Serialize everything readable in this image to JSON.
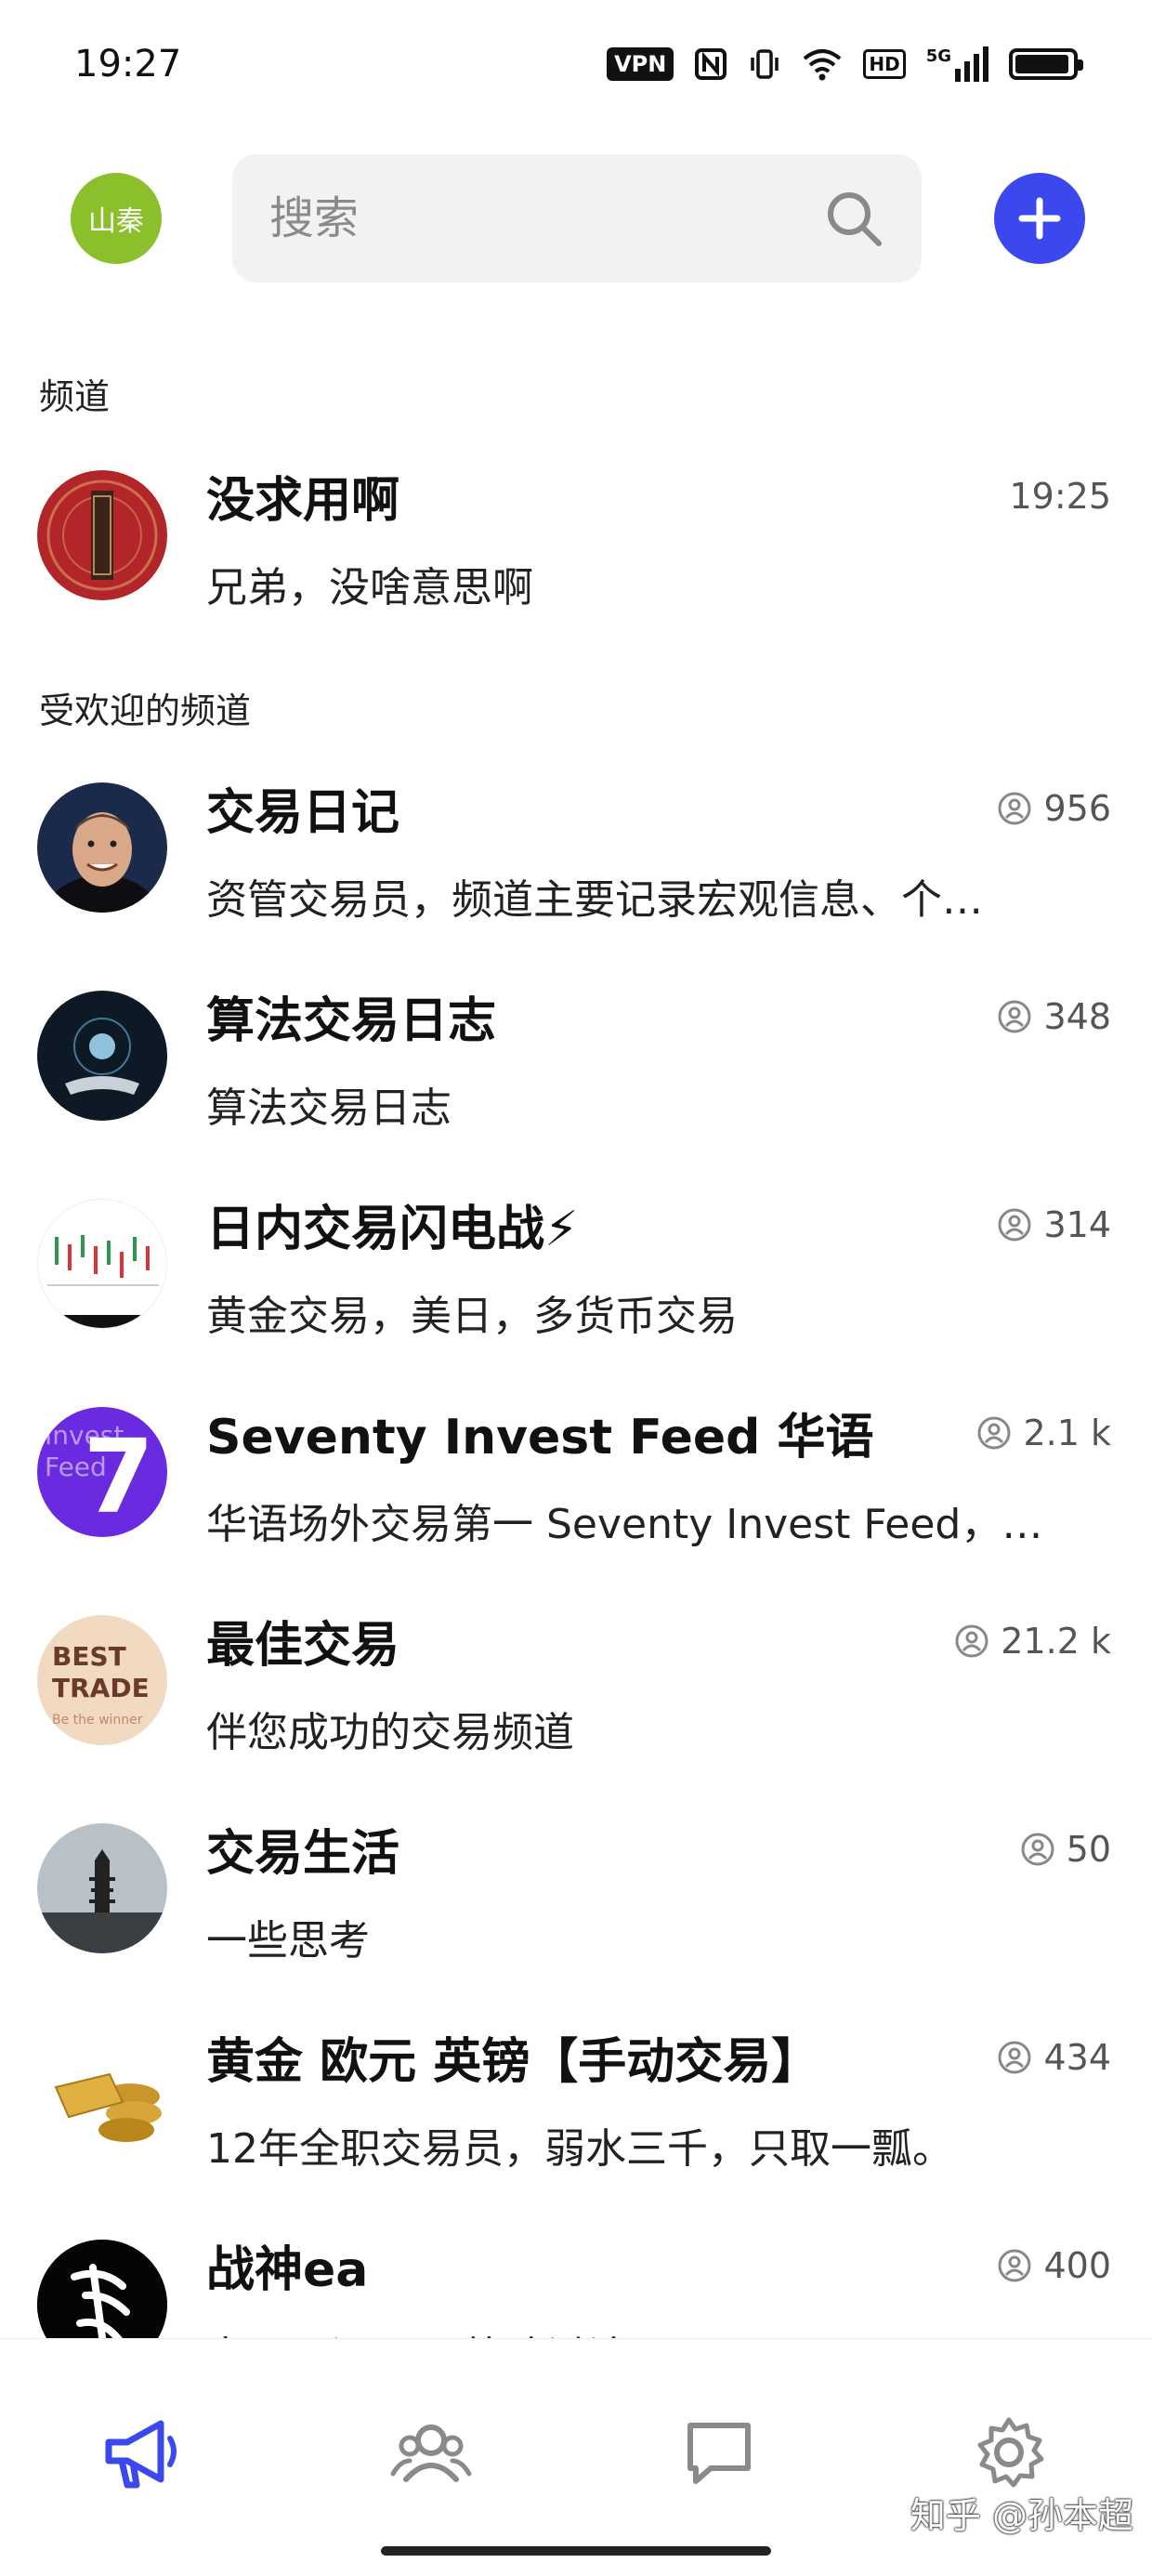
{
  "status_bar": {
    "time": "19:27",
    "vpn": "VPN",
    "icons": [
      "nfc-icon",
      "vibrate-icon",
      "wifi-icon",
      "hd-icon",
      "5g-signal-icon",
      "battery-icon"
    ],
    "hd": "HD",
    "network": "5G",
    "battery_level": 0.95
  },
  "header": {
    "avatar_text": "山秦",
    "search_placeholder": "搜索",
    "avatar_color": "#8cbf2c",
    "add_button_color": "#3a48ee"
  },
  "sections": {
    "channels_label": "频道",
    "popular_label": "受欢迎的频道"
  },
  "my_channels": [
    {
      "title": "没求用啊",
      "subtitle": "兄弟，没啥意思啊",
      "time": "19:25"
    }
  ],
  "popular_channels": [
    {
      "title": "交易日记",
      "subtitle": "资管交易员，频道主要记录宏观信息、个…",
      "members": "956"
    },
    {
      "title": "算法交易日志",
      "subtitle": "算法交易日志",
      "members": "348"
    },
    {
      "title": "日内交易闪电战⚡",
      "subtitle": "黄金交易，美日，多货币交易",
      "members": "314"
    },
    {
      "title": "Seventy Invest Feed 华语",
      "subtitle": "华语场外交易第一 Seventy Invest Feed，…",
      "members": "2.1 k",
      "avatar_text_1": "Invest",
      "avatar_text_2": "Feed",
      "avatar_digit": "7"
    },
    {
      "title": "最佳交易",
      "subtitle": "伴您成功的交易频道",
      "members": "21.2 k",
      "avatar_text_1": "BEST",
      "avatar_text_2": "TRADE",
      "avatar_text_3": "Be the winner"
    },
    {
      "title": "交易生活",
      "subtitle": "一些思考",
      "members": "50"
    },
    {
      "title": "黄金 欧元 英镑【手动交易】",
      "subtitle": "12年全职交易员，弱水三千，只取一瓢。",
      "members": "434"
    },
    {
      "title": "战神ea",
      "subtitle": "交易日记，EA策略讨论",
      "members": "400"
    }
  ],
  "bottom_nav": {
    "items": [
      "channels-megaphone-icon",
      "contacts-icon",
      "chat-icon",
      "settings-gear-icon"
    ],
    "active_color": "#3a48ee",
    "inactive_color": "#8a8a8a"
  },
  "watermark": "知乎 @孙本超"
}
